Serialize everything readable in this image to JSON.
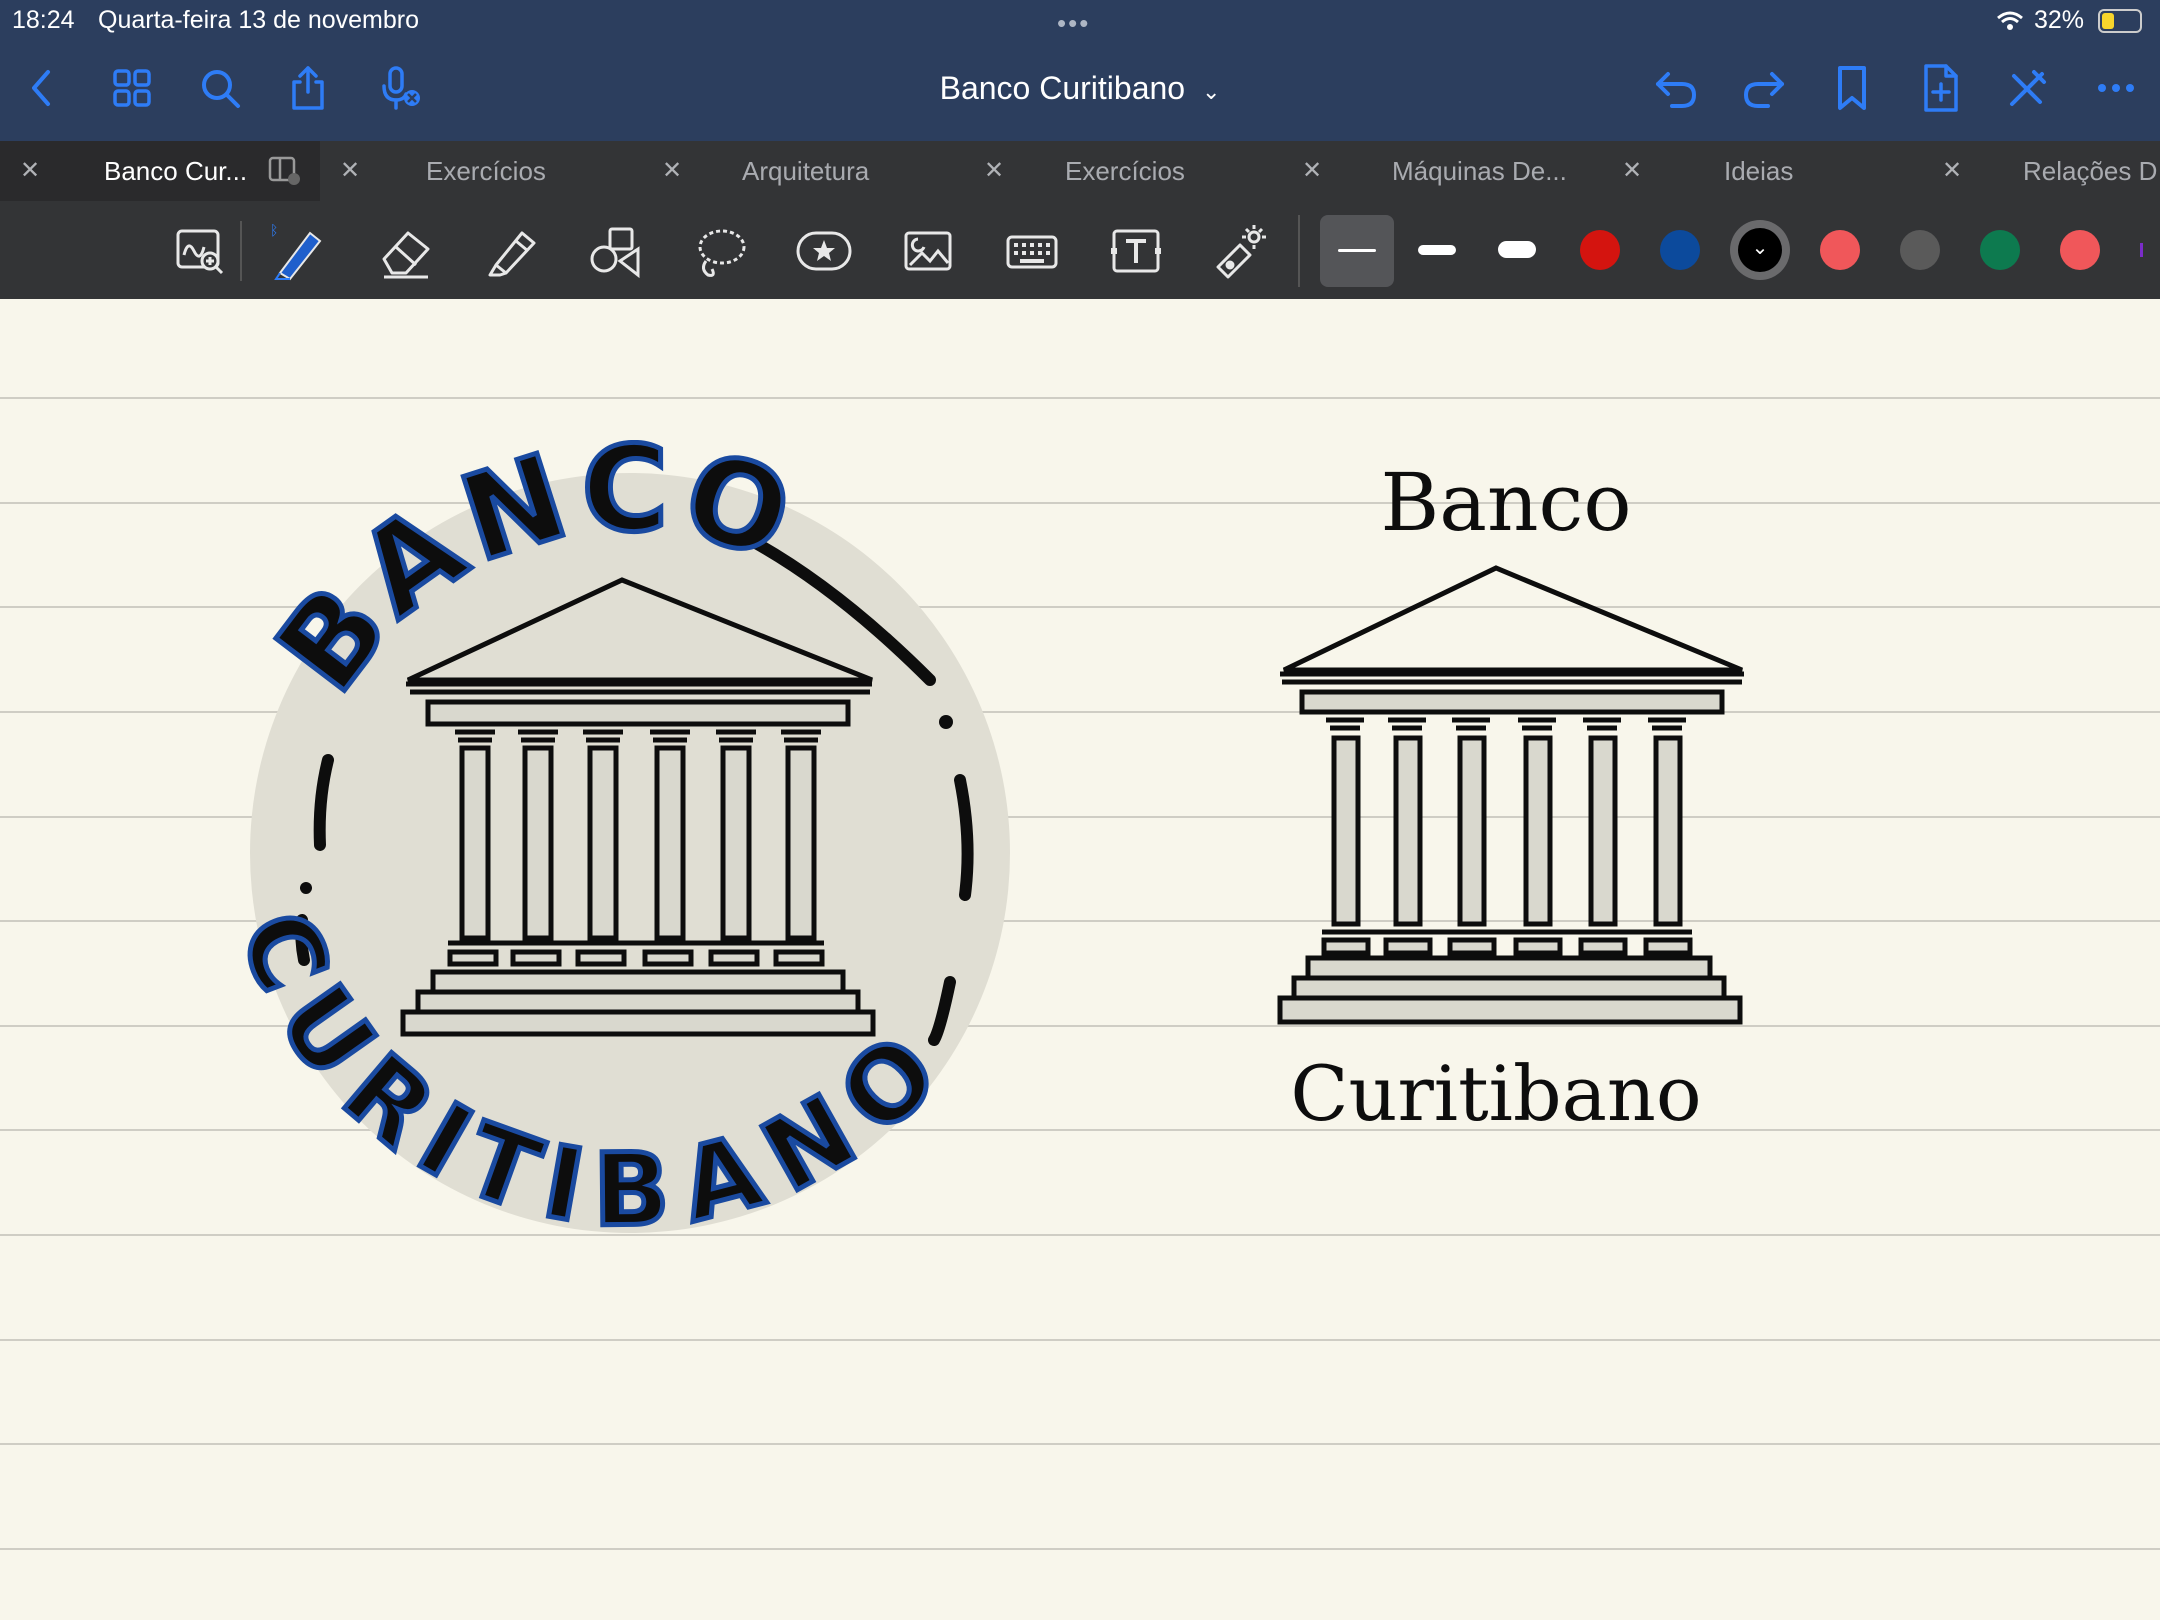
{
  "status_bar": {
    "time": "18:24",
    "date": "Quarta-feira 13 de novembro",
    "battery": "32%"
  },
  "document": {
    "title": "Banco Curitibano"
  },
  "tabs": [
    {
      "label": "Banco Cur...",
      "active": true
    },
    {
      "label": "Exercícios",
      "active": false
    },
    {
      "label": "Arquitetura",
      "active": false
    },
    {
      "label": "Exercícios",
      "active": false
    },
    {
      "label": "Máquinas De...",
      "active": false
    },
    {
      "label": "Ideias",
      "active": false
    },
    {
      "label": "Relações D",
      "active": false
    }
  ],
  "toolbar": {
    "tools": [
      "zoom-window-icon",
      "pen-icon",
      "eraser-icon",
      "highlighter-icon",
      "shapes-icon",
      "lasso-icon",
      "sticker-icon",
      "image-icon",
      "keyboard-icon",
      "text-box-icon",
      "laser-pointer-icon"
    ],
    "colors": [
      "#d4140f",
      "#0c4a9c",
      "#000000",
      "#f0575a",
      "#5a5a5a",
      "#0d7a4f",
      "#f0575a"
    ],
    "selected_color": "#000000"
  },
  "canvas": {
    "hand_logo": {
      "top_text": "BANCO",
      "bottom_text": "CURITIBANO"
    },
    "typed_logo": {
      "top_text": "Banco",
      "bottom_text": "Curitibano"
    }
  },
  "colors": {
    "nav_bg": "#2c3e5e",
    "accent": "#2e7cf6",
    "paper": "#f8f6eb"
  }
}
